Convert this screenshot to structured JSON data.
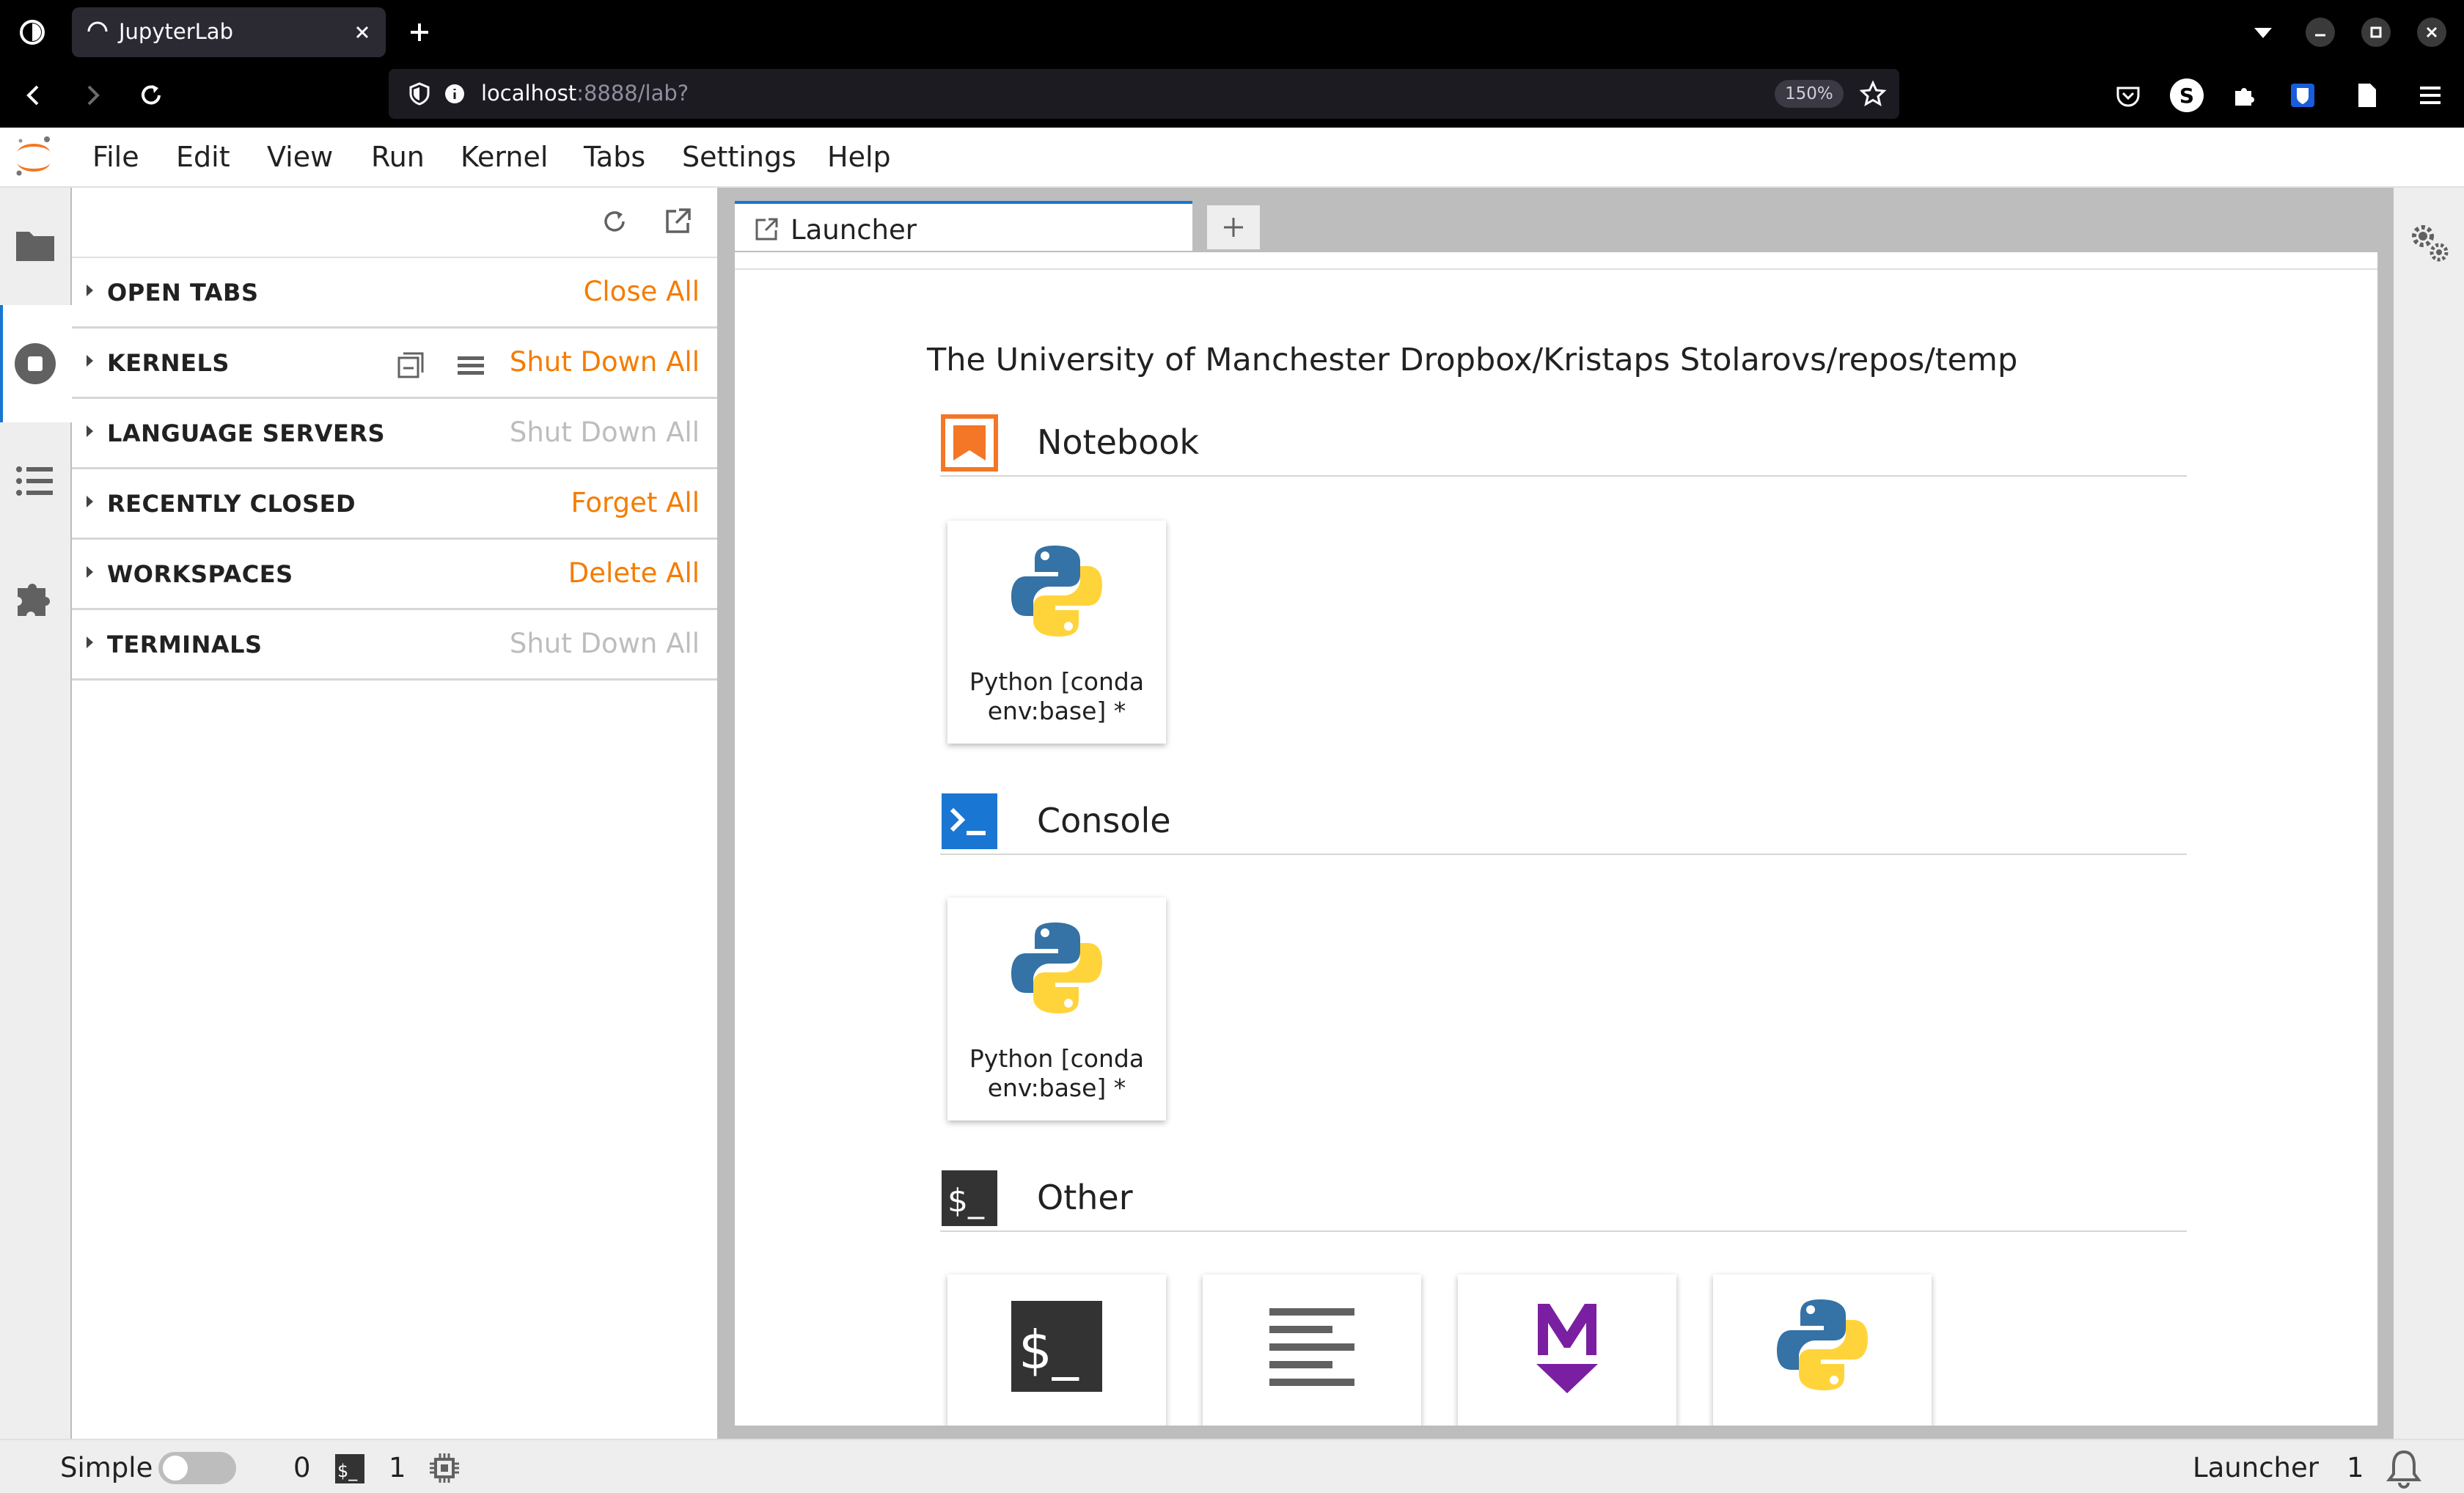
{
  "browser": {
    "tab_title": "JupyterLab",
    "url_host": "localhost",
    "url_rest": ":8888/lab?",
    "zoom": "150%",
    "profile_letter": "S"
  },
  "menubar": {
    "items": [
      "File",
      "Edit",
      "View",
      "Run",
      "Kernel",
      "Tabs",
      "Settings",
      "Help"
    ]
  },
  "running_panel": {
    "sections": [
      {
        "label": "OPEN TABS",
        "action": "Close All",
        "enabled": true
      },
      {
        "label": "KERNELS",
        "action": "Shut Down All",
        "enabled": true
      },
      {
        "label": "LANGUAGE SERVERS",
        "action": "Shut Down All",
        "enabled": false
      },
      {
        "label": "RECENTLY CLOSED",
        "action": "Forget All",
        "enabled": true
      },
      {
        "label": "WORKSPACES",
        "action": "Delete All",
        "enabled": true
      },
      {
        "label": "TERMINALS",
        "action": "Shut Down All",
        "enabled": false
      }
    ]
  },
  "main": {
    "tab_label": "Launcher",
    "cwd": "The University of Manchester Dropbox/Kristaps Stolarovs/repos/temp",
    "categories": [
      {
        "title": "Notebook",
        "cards": [
          {
            "label": "Python [conda env:base] *"
          }
        ]
      },
      {
        "title": "Console",
        "cards": [
          {
            "label": "Python [conda env:base] *"
          }
        ]
      },
      {
        "title": "Other",
        "cards": [
          {
            "icon": "terminal-icon"
          },
          {
            "icon": "text-file-icon"
          },
          {
            "icon": "markdown-icon"
          },
          {
            "icon": "python-file-icon"
          }
        ]
      }
    ]
  },
  "statusbar": {
    "mode_label": "Simple",
    "kernel_count": "0",
    "terminal_count": "1",
    "current_activity": "Launcher",
    "notification_count": "1"
  },
  "colors": {
    "accent": "#f57c00",
    "disabled": "#bdbdbd",
    "brand_blue": "#1976d2",
    "markdown_purple": "#7b1fa2"
  }
}
